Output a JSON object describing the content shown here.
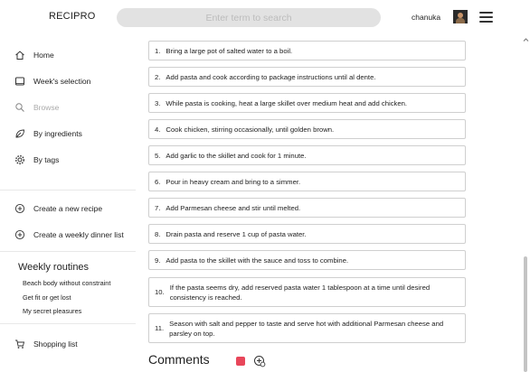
{
  "header": {
    "logo": "RECIPRO",
    "search_placeholder": "Enter term to search",
    "username": "chanuka"
  },
  "sidebar": {
    "nav": [
      {
        "label": "Home",
        "icon": "home-icon"
      },
      {
        "label": "Week's selection",
        "icon": "tablet-icon"
      },
      {
        "label": "Browse",
        "icon": "browse-search-icon",
        "disabled": true
      },
      {
        "label": "By ingredients",
        "icon": "leaf-icon"
      },
      {
        "label": "By tags",
        "icon": "gear-icon"
      }
    ],
    "actions": [
      {
        "label": "Create a new recipe",
        "icon": "plus-circle-icon"
      },
      {
        "label": "Create a weekly dinner list",
        "icon": "plus-circle-icon"
      }
    ],
    "routines_title": "Weekly routines",
    "routines": [
      "Beach body without constraint",
      "Get fit or get lost",
      "My secret pleasures"
    ],
    "shopping_list": {
      "label": "Shopping list",
      "icon": "cart-icon"
    }
  },
  "steps": [
    {
      "num": "1.",
      "text": "Bring a large pot of salted water to a boil."
    },
    {
      "num": "2.",
      "text": "Add pasta and cook according to package instructions until al dente."
    },
    {
      "num": "3.",
      "text": "While pasta is cooking, heat a large skillet over medium heat and add chicken."
    },
    {
      "num": "4.",
      "text": "Cook chicken, stirring occasionally, until golden brown."
    },
    {
      "num": "5.",
      "text": "Add garlic to the skillet and cook for 1 minute."
    },
    {
      "num": "6.",
      "text": "Pour in heavy cream and bring to a simmer."
    },
    {
      "num": "7.",
      "text": "Add Parmesan cheese and stir until melted."
    },
    {
      "num": "8.",
      "text": "Drain pasta and reserve 1 cup of pasta water."
    },
    {
      "num": "9.",
      "text": "Add pasta to the skillet with the sauce and toss to combine."
    },
    {
      "num": "10.",
      "text": "If the pasta seems dry, add reserved pasta water 1 tablespoon at a time until desired consistency is reached."
    },
    {
      "num": "11.",
      "text": "Season with salt and pepper to taste and serve hot with additional Parmesan cheese and parsley on top."
    }
  ],
  "comments": {
    "title": "Comments"
  },
  "colors": {
    "accent_red": "#e8465a",
    "search_bg": "#e2e2e2",
    "border": "#cfcfcf"
  }
}
